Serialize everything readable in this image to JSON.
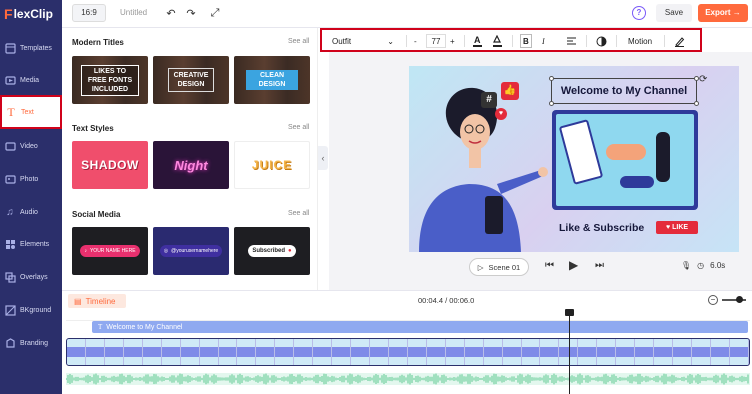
{
  "app": {
    "logo_mark": "F",
    "logo_text": "lexClip"
  },
  "sidebar": {
    "items": [
      {
        "label": "Templates",
        "icon": "templates-icon"
      },
      {
        "label": "Media",
        "icon": "media-icon"
      },
      {
        "label": "Text",
        "icon": "text-icon",
        "active": true
      },
      {
        "label": "Video",
        "icon": "video-icon"
      },
      {
        "label": "Photo",
        "icon": "photo-icon"
      },
      {
        "label": "Audio",
        "icon": "audio-icon"
      },
      {
        "label": "Elements",
        "icon": "elements-icon"
      },
      {
        "label": "Overlays",
        "icon": "overlays-icon"
      },
      {
        "label": "BKground",
        "icon": "background-icon"
      },
      {
        "label": "Branding",
        "icon": "branding-icon"
      }
    ]
  },
  "topbar": {
    "ratio": "16:9",
    "title": "Untitled",
    "help": "?",
    "save": "Save",
    "export": "Export"
  },
  "panel": {
    "sections": [
      {
        "title": "Modern Titles",
        "see_all": "See all",
        "cards": [
          "LIKES TO FREE FONTS INCLUDED",
          "CREATIVE DESIGN",
          "CLEAN DESIGN"
        ]
      },
      {
        "title": "Text Styles",
        "see_all": "See all",
        "cards": [
          "SHADOW",
          "Night",
          "JUICE"
        ]
      },
      {
        "title": "Social Media",
        "see_all": "See all",
        "cards": [
          "YOUR NAME HERE",
          "@yourusernamehere",
          "Subscribed"
        ]
      }
    ]
  },
  "toolbar": {
    "font": "Outfit",
    "minus": "-",
    "size": "77",
    "plus": "+",
    "motion": "Motion"
  },
  "canvas": {
    "headline": "Welcome to My Channel",
    "subscribe": "Like & Subscribe",
    "like_badge": "LIKE",
    "hash": "#",
    "scene": "Scene 01",
    "duration": "6.0s"
  },
  "timeline": {
    "label": "Timeline",
    "time": "00:04.4 / 00:06.0",
    "text_track": "Welcome to My Channel"
  },
  "colors": {
    "accent": "#ff6a3d",
    "sidebar": "#2b2f6b",
    "highlight": "#d0021b"
  }
}
